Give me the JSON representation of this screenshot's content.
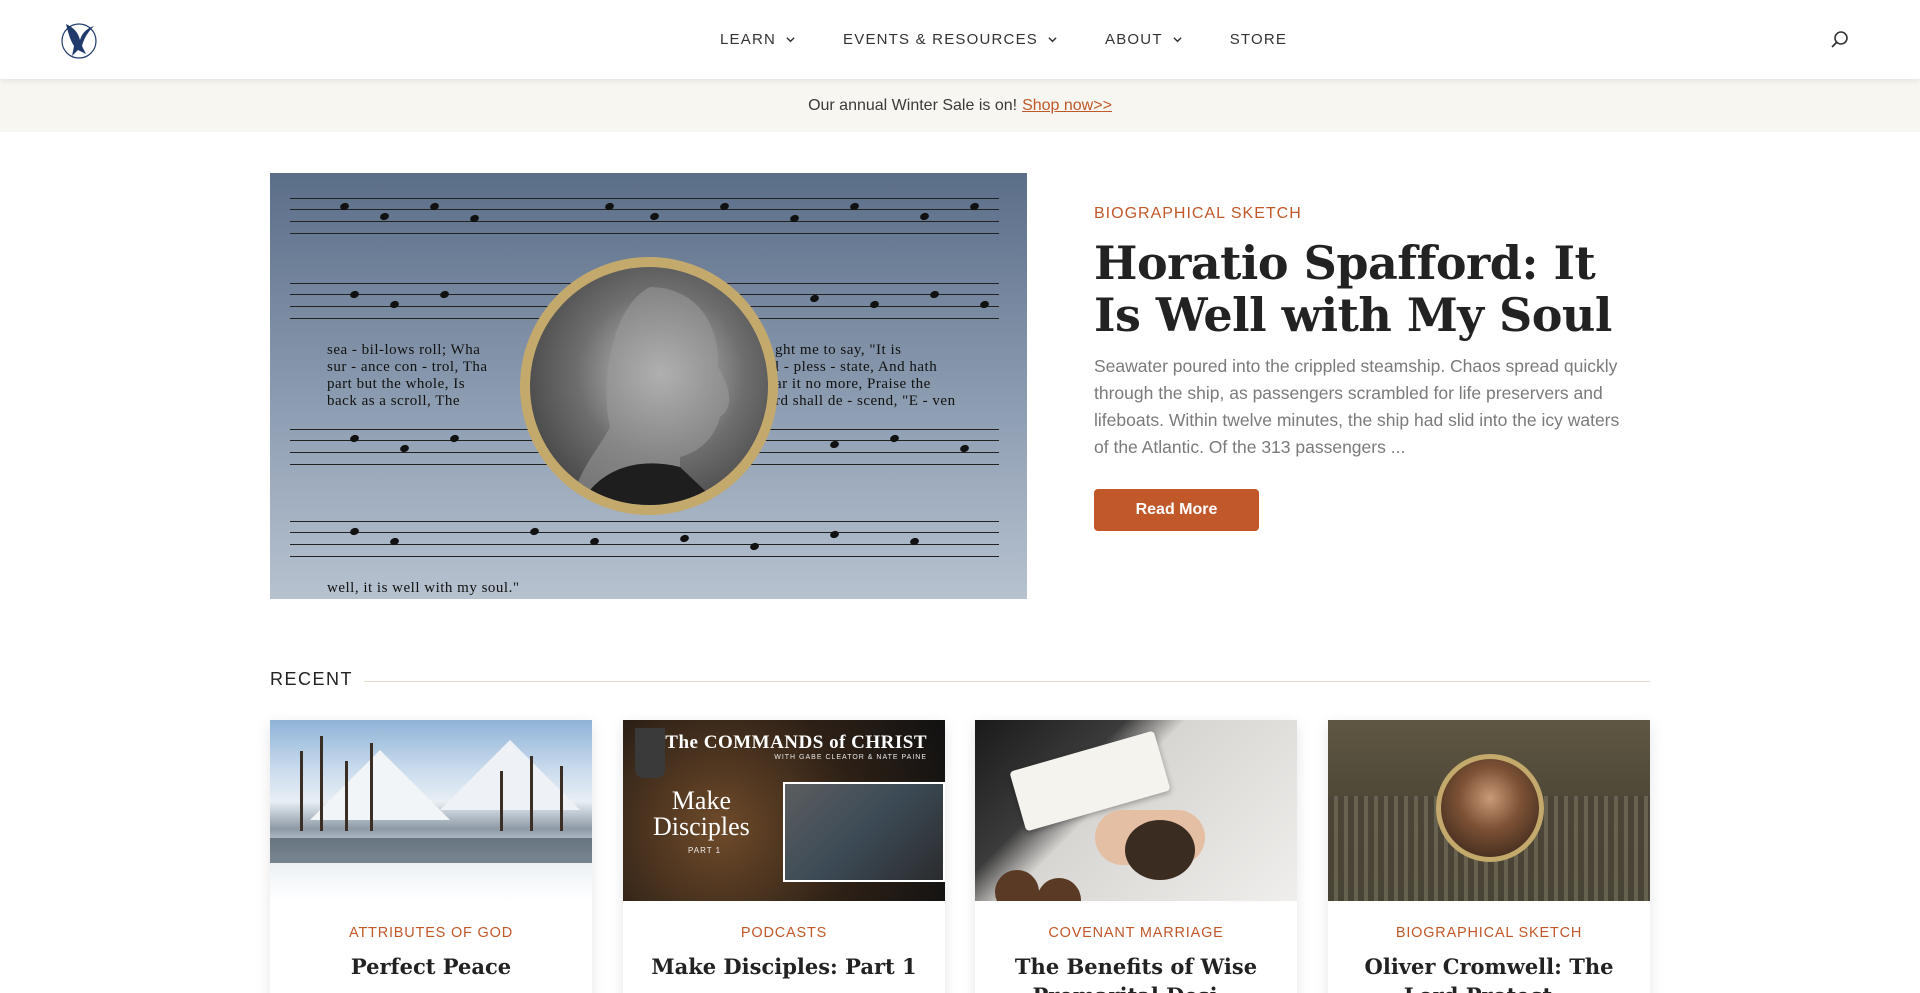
{
  "header": {
    "logo_name": "eagle-logo",
    "nav": [
      {
        "label": "LEARN",
        "has_dropdown": true
      },
      {
        "label": "EVENTS & RESOURCES",
        "has_dropdown": true
      },
      {
        "label": "ABOUT",
        "has_dropdown": true
      },
      {
        "label": "STORE",
        "has_dropdown": false
      }
    ],
    "search_icon": "search-icon"
  },
  "promo": {
    "text": "Our annual Winter Sale is on!",
    "link": "Shop now>>"
  },
  "feature": {
    "kicker": "BIOGRAPHICAL SKETCH",
    "title": "Horatio Spafford: It Is Well with My Soul",
    "excerpt": "Seawater poured into the crippled steamship. Chaos spread quickly through the ship, as passengers scrambled for life preservers and lifeboats. Within twelve minutes, the ship had slid into the icy waters of the Atlantic. Of the 313 passengers ...",
    "button": "Read More",
    "image": {
      "lyrics_1": "sea - bil-lows roll; Wha",
      "lyrics_2": "sur - ance con - trol, Tha",
      "lyrics_3": "part but the whole, Is",
      "lyrics_4": "back as a scroll, The",
      "lyrics_r1": "ght me to say, \"It is",
      "lyrics_r2": "l - pless - state, And hath",
      "lyrics_r3": "ar it no more, Praise the",
      "lyrics_r4": "rd shall de - scend, \"E - ven",
      "lyrics_bottom": "well, it is well with my soul.\""
    }
  },
  "recent": {
    "heading": "RECENT",
    "cards": [
      {
        "kicker": "ATTRIBUTES OF GOD",
        "title": "Perfect Peace"
      },
      {
        "kicker": "PODCASTS",
        "title": "Make Disciples: Part 1",
        "image_brand": "The COMMANDS of CHRIST",
        "image_sub": "WITH GABE CLEATOR & NATE PAINE",
        "image_big_1": "Make",
        "image_big_2": "Disciples",
        "image_part": "PART 1"
      },
      {
        "kicker": "COVENANT MARRIAGE",
        "title": "The Benefits of Wise Premarital Desi..."
      },
      {
        "kicker": "BIOGRAPHICAL SKETCH",
        "title": "Oliver Cromwell: The Lord Protect..."
      }
    ]
  },
  "colors": {
    "accent": "#c0582a",
    "promo_bg": "#f8f6f0",
    "text": "#222222"
  }
}
